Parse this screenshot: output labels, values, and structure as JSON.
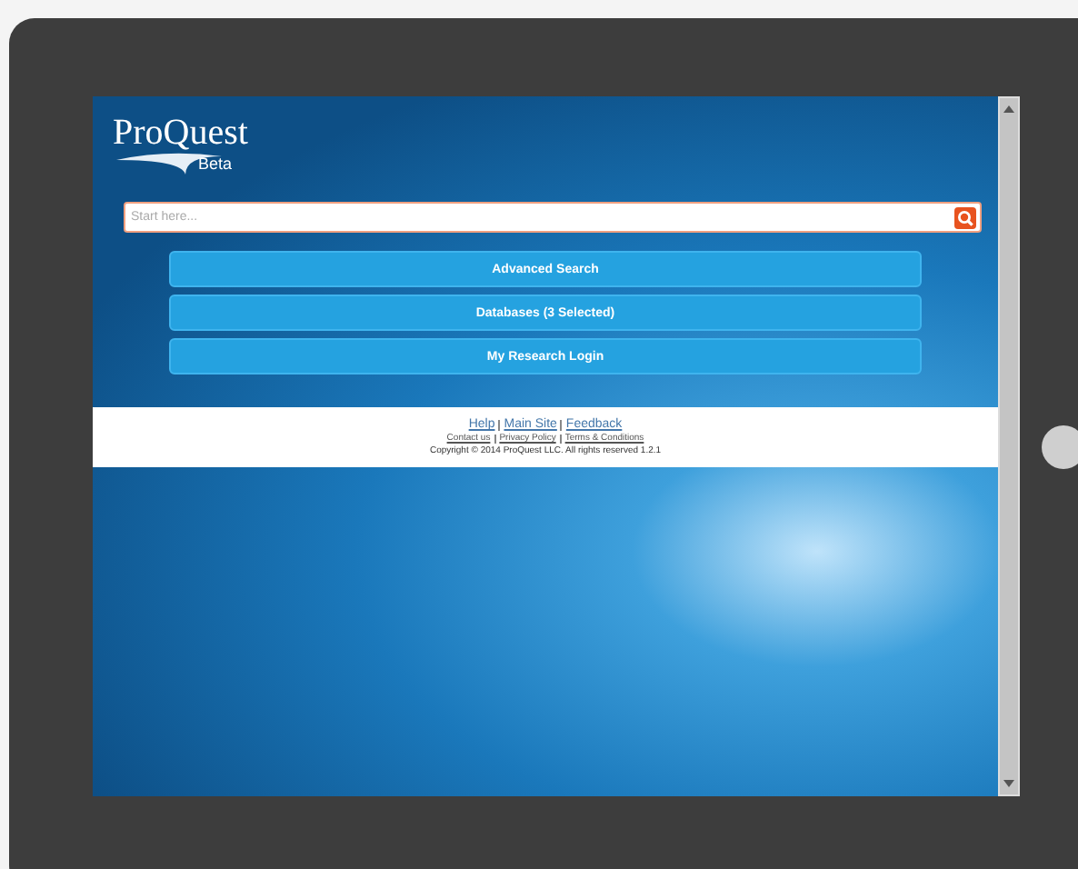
{
  "logo": {
    "name": "ProQuest",
    "tag": "Beta"
  },
  "search": {
    "placeholder": "Start here..."
  },
  "buttons": [
    "Advanced Search",
    "Databases (3 Selected)",
    "My Research Login"
  ],
  "footer": {
    "primary_links": [
      "Help",
      "Main Site",
      "Feedback"
    ],
    "secondary_links": [
      "Contact us",
      "Privacy Policy",
      "Terms & Conditions"
    ],
    "copyright": "Copyright © 2014 ProQuest LLC. All rights reserved 1.2.1"
  }
}
